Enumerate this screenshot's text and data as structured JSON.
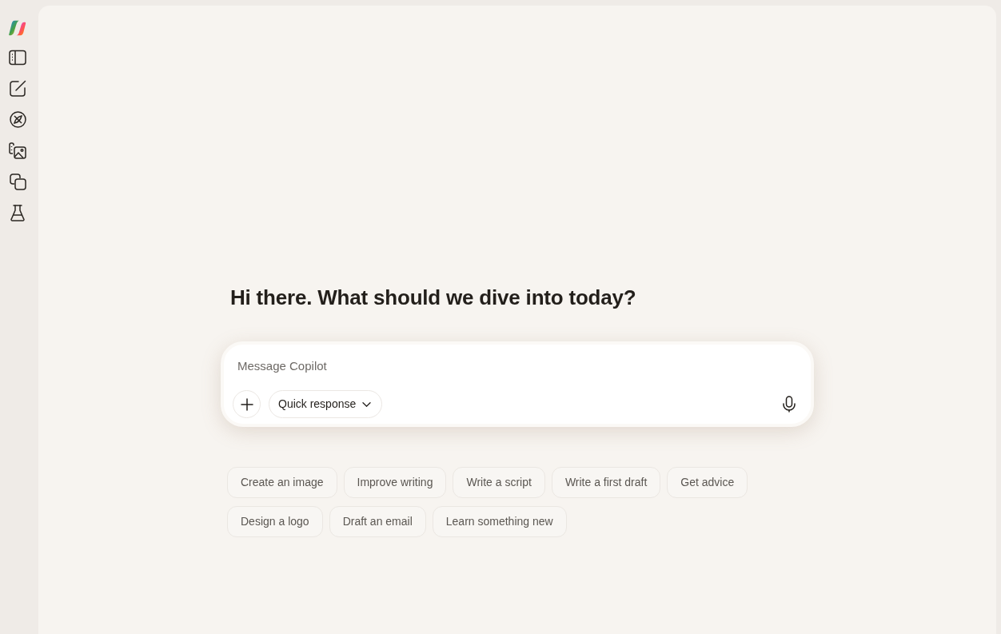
{
  "greeting": "Hi there. What should we dive into today?",
  "composer": {
    "placeholder": "Message Copilot",
    "mode": "Quick response"
  },
  "suggestions": [
    "Create an image",
    "Improve writing",
    "Write a script",
    "Write a first draft",
    "Get advice",
    "Design a logo",
    "Draft an email",
    "Learn something new"
  ]
}
